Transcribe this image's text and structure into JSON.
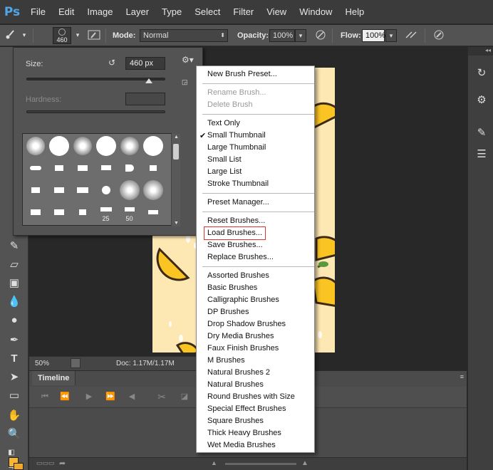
{
  "app": {
    "logo": "Ps"
  },
  "menubar": {
    "items": [
      "File",
      "Edit",
      "Image",
      "Layer",
      "Type",
      "Select",
      "Filter",
      "View",
      "Window",
      "Help"
    ]
  },
  "options_bar": {
    "brush_size_value": "460",
    "mode_label": "Mode:",
    "mode_value": "Normal",
    "opacity_label": "Opacity:",
    "opacity_value": "100%",
    "flow_label": "Flow:",
    "flow_value": "100%"
  },
  "brush_panel": {
    "size_label": "Size:",
    "size_value": "460 px",
    "hardness_label": "Hardness:",
    "hardness_value": "",
    "size_slider_fraction": 0.88,
    "brush_numbers": [
      "25",
      "50"
    ]
  },
  "context_menu": {
    "group1": [
      {
        "label": "New Brush Preset...",
        "enabled": true
      }
    ],
    "group2": [
      {
        "label": "Rename Brush...",
        "enabled": false
      },
      {
        "label": "Delete Brush",
        "enabled": false
      }
    ],
    "group3": [
      {
        "label": "Text Only",
        "checked": false
      },
      {
        "label": "Small Thumbnail",
        "checked": true
      },
      {
        "label": "Large Thumbnail",
        "checked": false
      },
      {
        "label": "Small List",
        "checked": false
      },
      {
        "label": "Large List",
        "checked": false
      },
      {
        "label": "Stroke Thumbnail",
        "checked": false
      }
    ],
    "group4": [
      {
        "label": "Preset Manager..."
      }
    ],
    "group5": [
      {
        "label": "Reset Brushes...",
        "highlighted": false
      },
      {
        "label": "Load Brushes...",
        "highlighted": true
      },
      {
        "label": "Save Brushes...",
        "highlighted": false
      },
      {
        "label": "Replace Brushes...",
        "highlighted": false
      }
    ],
    "group6": [
      "Assorted Brushes",
      "Basic Brushes",
      "Calligraphic Brushes",
      "DP Brushes",
      "Drop Shadow Brushes",
      "Dry Media Brushes",
      "Faux Finish Brushes",
      "M Brushes",
      "Natural Brushes 2",
      "Natural Brushes",
      "Round Brushes with Size",
      "Special Effect Brushes",
      "Square Brushes",
      "Thick Heavy Brushes",
      "Wet Media Brushes"
    ],
    "check_mark": "✔"
  },
  "status": {
    "zoom": "50%",
    "doc_info": "Doc: 1.17M/1.17M"
  },
  "timeline": {
    "tab_label": "Timeline"
  },
  "colors": {
    "foreground": "#f7b733",
    "highlight_outline": "#dd3333",
    "ps_blue": "#4fa6e8"
  },
  "icons": {
    "tools": [
      "brush-icon",
      "eraser-icon",
      "gradient-icon",
      "blur-icon",
      "dodge-icon",
      "pen-icon",
      "type-icon",
      "path-select-icon",
      "rectangle-icon",
      "hand-icon",
      "zoom-icon"
    ],
    "right": [
      "history-icon",
      "properties-icon",
      "brush-presets-icon",
      "adjustments-icon"
    ]
  }
}
